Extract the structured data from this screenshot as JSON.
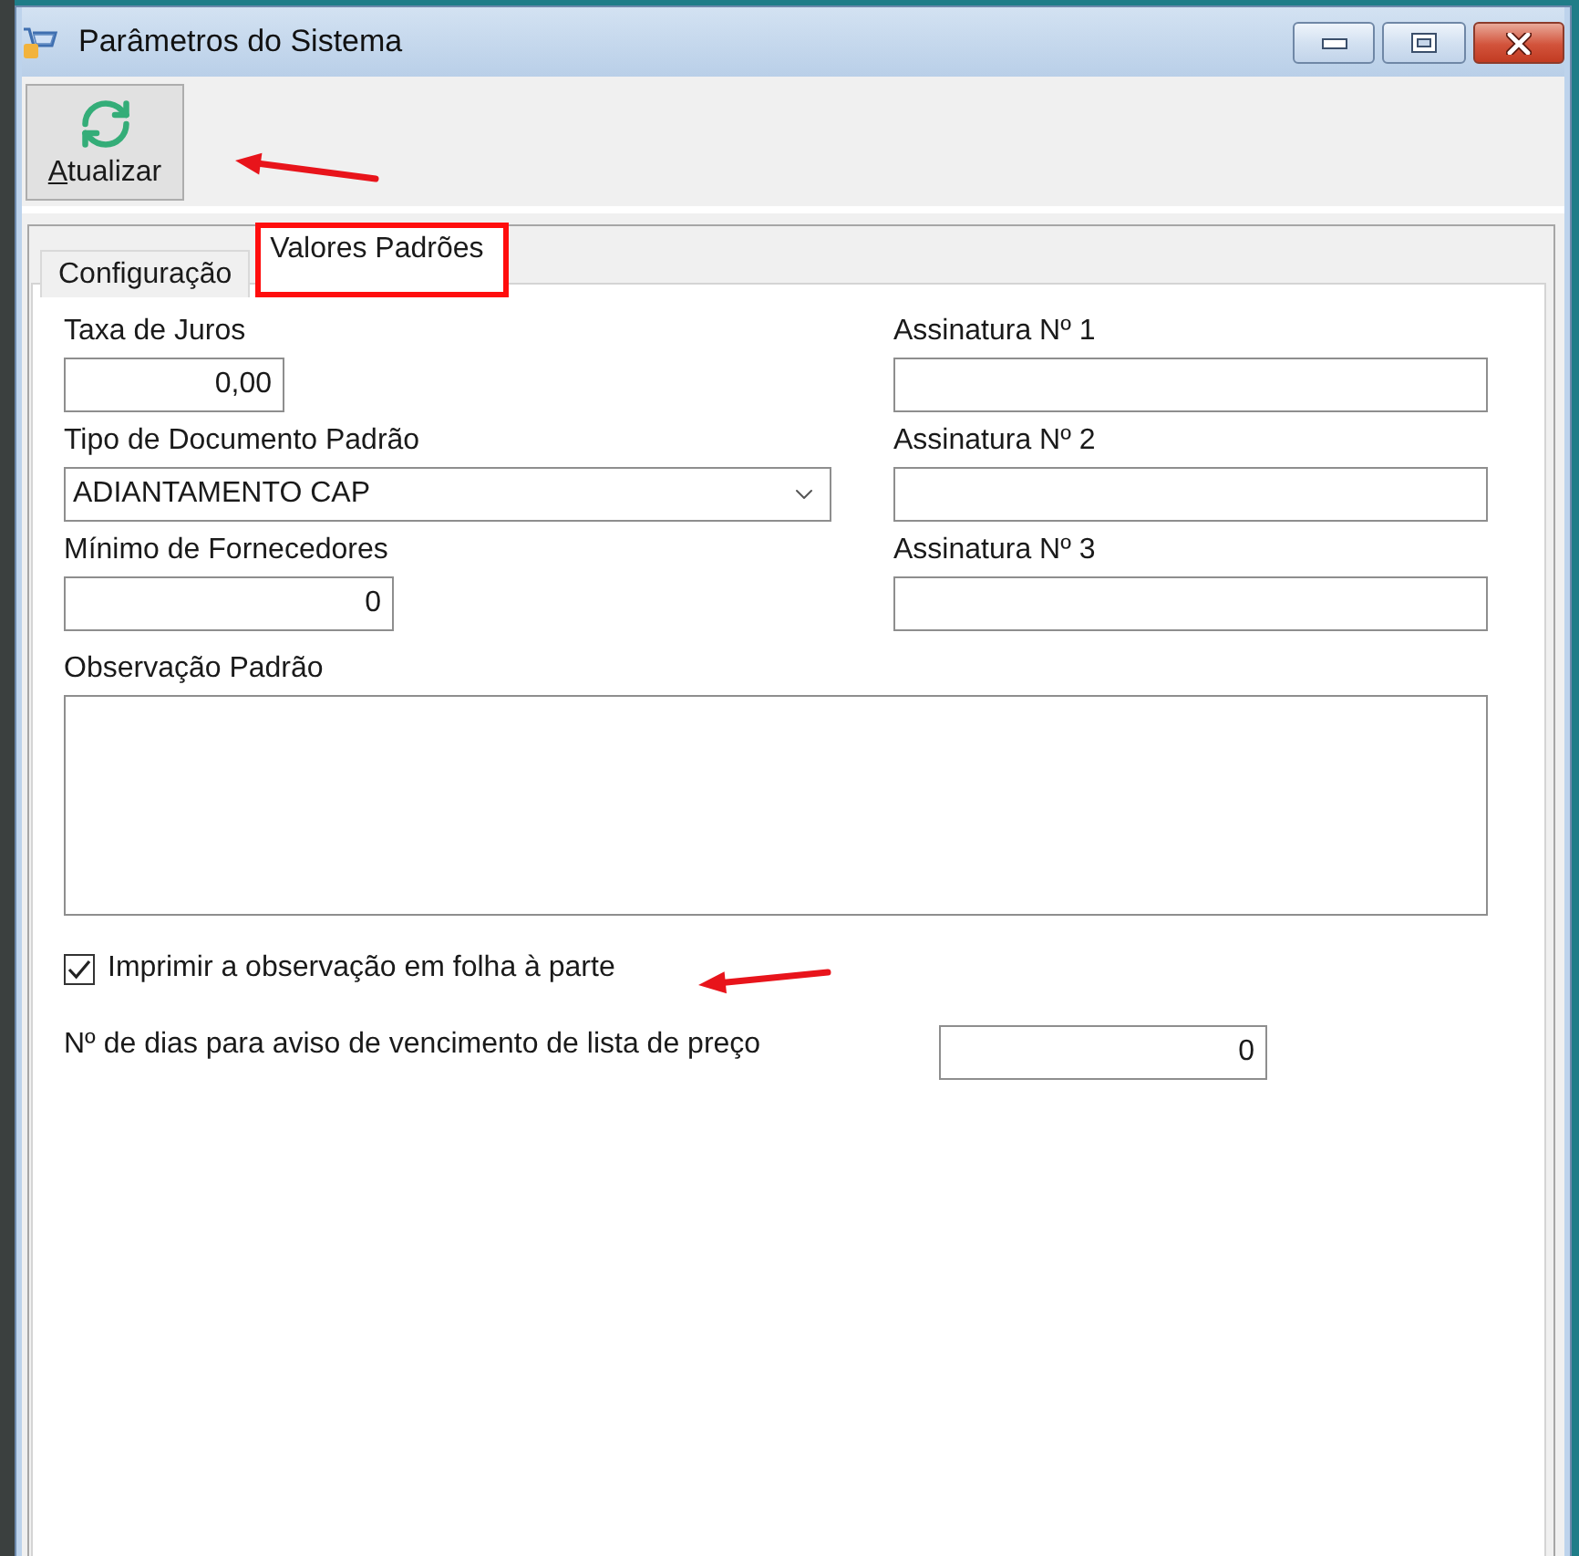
{
  "window": {
    "title": "Parâmetros do Sistema"
  },
  "toolbar": {
    "buttons": [
      {
        "label": "Atualizar",
        "mnemonic_first": true,
        "arrow_marker": true
      }
    ]
  },
  "tabs": [
    {
      "label": "Configuração",
      "selected": false,
      "highlighted": false
    },
    {
      "label": "Valores Padrões",
      "selected": true,
      "highlighted": true
    }
  ],
  "form": {
    "left_fields": [
      {
        "kind": "number",
        "label": "Taxa de Juros",
        "value": "0,00"
      },
      {
        "kind": "dropdown",
        "label": "Tipo de Documento Padrão",
        "value": "ADIANTAMENTO CAP"
      },
      {
        "kind": "number",
        "label": "Mínimo de Fornecedores",
        "value": "0"
      }
    ],
    "right_fields": [
      {
        "kind": "text",
        "label": "Assinatura Nº 1"
      },
      {
        "kind": "text",
        "label": "Assinatura Nº 2"
      },
      {
        "kind": "text",
        "label": "Assinatura Nº 3"
      }
    ],
    "notes": {
      "label": "Observação Padrão"
    },
    "print_option": {
      "label": "Imprimir a observação em folha à parte",
      "checked": true,
      "arrow_marker": true
    },
    "reminder": {
      "label": "Nº de dias para aviso de vencimento de lista de preço",
      "value": "0"
    }
  }
}
